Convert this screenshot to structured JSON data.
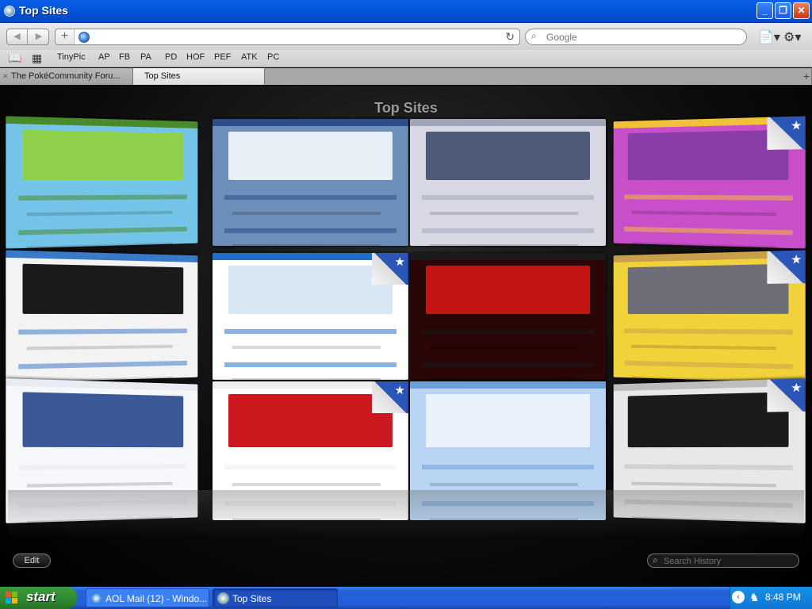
{
  "window": {
    "title": "Top Sites",
    "minimize": "_",
    "restore": "❐",
    "close": "✕"
  },
  "toolbar": {
    "back_icon": "◀",
    "forward_icon": "▶",
    "add_bookmark": "+",
    "address_value": "",
    "reload_icon": "↻",
    "search_placeholder": "Google",
    "search_icon": "⌕",
    "page_menu_icon": "📄▾",
    "settings_icon": "⚙▾"
  },
  "bookmarks": {
    "book_icon": "📖",
    "grid_icon": "▦",
    "items": [
      "TinyPic",
      "AP",
      "FB",
      "PA",
      "PD",
      "HOF",
      "PEF",
      "ATK",
      "PC"
    ]
  },
  "tabs": [
    {
      "label": "The PokéCommunity Foru...",
      "close": "✕"
    },
    {
      "label": "Top Sites"
    }
  ],
  "new_tab_icon": "+",
  "top_sites": {
    "heading": "Top Sites",
    "edit_label": "Edit",
    "history_search_placeholder": "Search History",
    "pin_icon": "★",
    "thumbnails": [
      {
        "site": "pokecommunity",
        "colors": [
          "#74c4e8",
          "#8ed04a",
          "#4a8a2a"
        ],
        "pinned": false
      },
      {
        "site": "hof-forums",
        "colors": [
          "#6c8fb9",
          "#e6eef6",
          "#2b4d8a"
        ],
        "pinned": false
      },
      {
        "site": "apocalypse-forums",
        "colors": [
          "#d8d8e4",
          "#4d5a78",
          "#a0a6b8"
        ],
        "pinned": false
      },
      {
        "site": "purple-forum",
        "colors": [
          "#c94ec9",
          "#8a3da8",
          "#f0c23a"
        ],
        "pinned": true
      },
      {
        "site": "apple-forum",
        "colors": [
          "#f3f3f3",
          "#1a1a1a",
          "#3a78c8"
        ],
        "pinned": false
      },
      {
        "site": "photobucket-upload",
        "colors": [
          "#ffffff",
          "#d9e7f5",
          "#1f6fc8"
        ],
        "pinned": true
      },
      {
        "site": "dark-red-forum",
        "colors": [
          "#2a0606",
          "#c41414",
          "#1a1a1a"
        ],
        "pinned": false
      },
      {
        "site": "pokemon-epiphany",
        "colors": [
          "#f2d23a",
          "#6e6e78",
          "#c9a04a"
        ],
        "pinned": true
      },
      {
        "site": "facebook",
        "colors": [
          "#f6f7fb",
          "#3b5998",
          "#e9ebf3"
        ],
        "pinned": false
      },
      {
        "site": "youtube",
        "colors": [
          "#ffffff",
          "#cc181e",
          "#eeeeee"
        ],
        "pinned": true
      },
      {
        "site": "all-things-kawaii",
        "colors": [
          "#b8d4f2",
          "#e9f1fb",
          "#6f9fd8"
        ],
        "pinned": false
      },
      {
        "site": "the-topic-lounge",
        "colors": [
          "#e8e8e8",
          "#1b1b1b",
          "#bdbdbd"
        ],
        "pinned": true
      }
    ]
  },
  "taskbar": {
    "start_label": "start",
    "tasks": [
      {
        "label": "AOL Mail (12) - Windo..."
      },
      {
        "label": "Top Sites"
      }
    ],
    "clock": "8:48 PM",
    "tray_back_icon": "‹",
    "tray_person_icon": "♞"
  }
}
